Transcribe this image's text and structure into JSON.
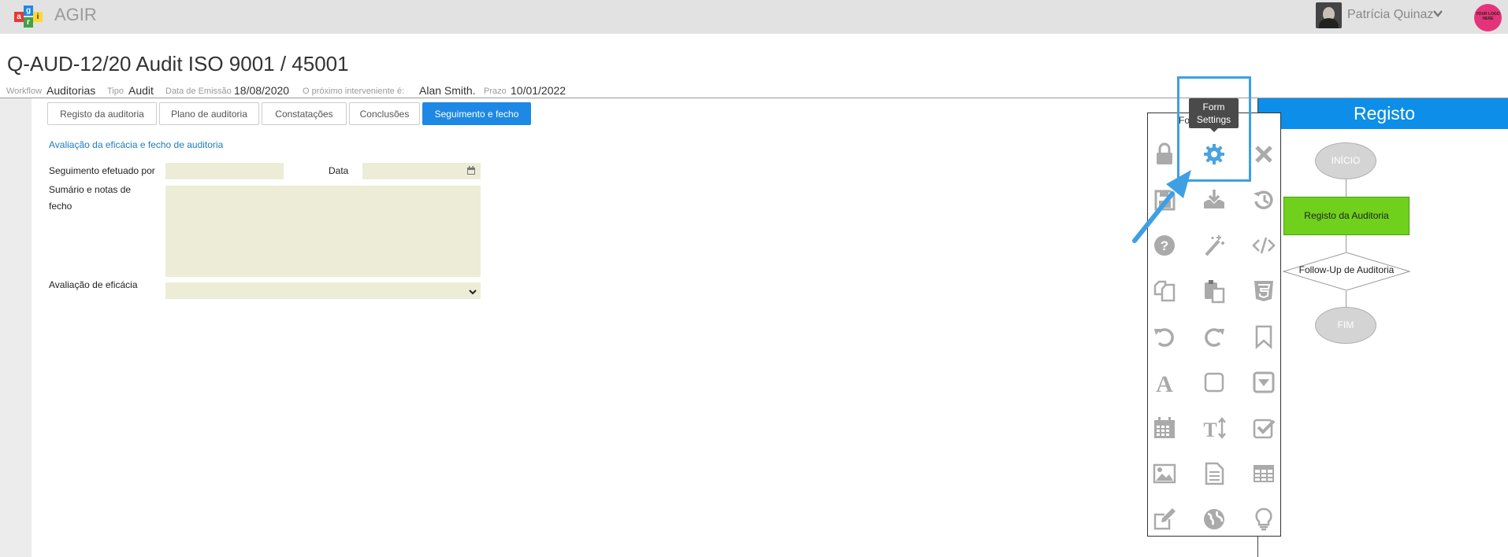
{
  "app": {
    "title": "AGIR",
    "logo_letters": [
      "a",
      "g",
      "i",
      "r"
    ]
  },
  "user": {
    "name": "Patrícia Quinaz",
    "brand_logo_text": "YOUR LOGO HERE"
  },
  "document": {
    "title": "Q-AUD-12/20 Audit ISO 9001 / 45001",
    "meta": {
      "workflow_label": "Workflow",
      "workflow_value": "Auditorias",
      "tipo_label": "Tipo",
      "tipo_value": "Audit",
      "data_emissao_label": "Data de Emissão",
      "data_emissao_value": "18/08/2020",
      "proximo_label": "O próximo interveniente é:",
      "proximo_value": "Alan Smith.",
      "prazo_label": "Prazo",
      "prazo_value": "10/01/2022"
    }
  },
  "tabs": [
    {
      "label": "Registo da auditoria",
      "active": false
    },
    {
      "label": "Plano de auditoria",
      "active": false
    },
    {
      "label": "Constatações",
      "active": false
    },
    {
      "label": "Conclusões",
      "active": false
    },
    {
      "label": "Seguimento e fecho",
      "active": true
    }
  ],
  "form": {
    "section_title": "Avaliação da eficácia e fecho de auditoria",
    "seguimento_label": "Seguimento efetuado por",
    "seguimento_value": "",
    "data_label": "Data",
    "data_value": "",
    "sumario_label": "Sumário e notas de fecho",
    "sumario_value": "",
    "avaliacao_label": "Avaliação de eficácia",
    "avaliacao_value": ""
  },
  "toolbox": {
    "title": "Form Builder",
    "tooltip": "Form Settings",
    "highlight_color": "#3ea0e4",
    "tools": [
      "lock-icon",
      "gear-icon",
      "close-icon",
      "save-icon",
      "download-tray-icon",
      "history-icon",
      "help-icon",
      "magic-wand-icon",
      "code-icon",
      "copy-icon",
      "paste-icon",
      "css3-icon",
      "undo-icon",
      "redo-icon",
      "bookmark-icon",
      "font-icon",
      "square-icon",
      "dropdown-box-icon",
      "calendar-icon",
      "text-height-icon",
      "checkbox-icon",
      "image-icon",
      "document-icon",
      "table-icon",
      "edit-icon",
      "globe-icon",
      "lightbulb-icon"
    ]
  },
  "workflow_panel": {
    "header": "Registo",
    "header_color": "#0d8ee8",
    "start": "INÍCIO",
    "step1": "Registo da Auditoria",
    "step1_color": "#6fd11c",
    "decision": "Follow-Up de Auditoria",
    "end": "FIM"
  }
}
